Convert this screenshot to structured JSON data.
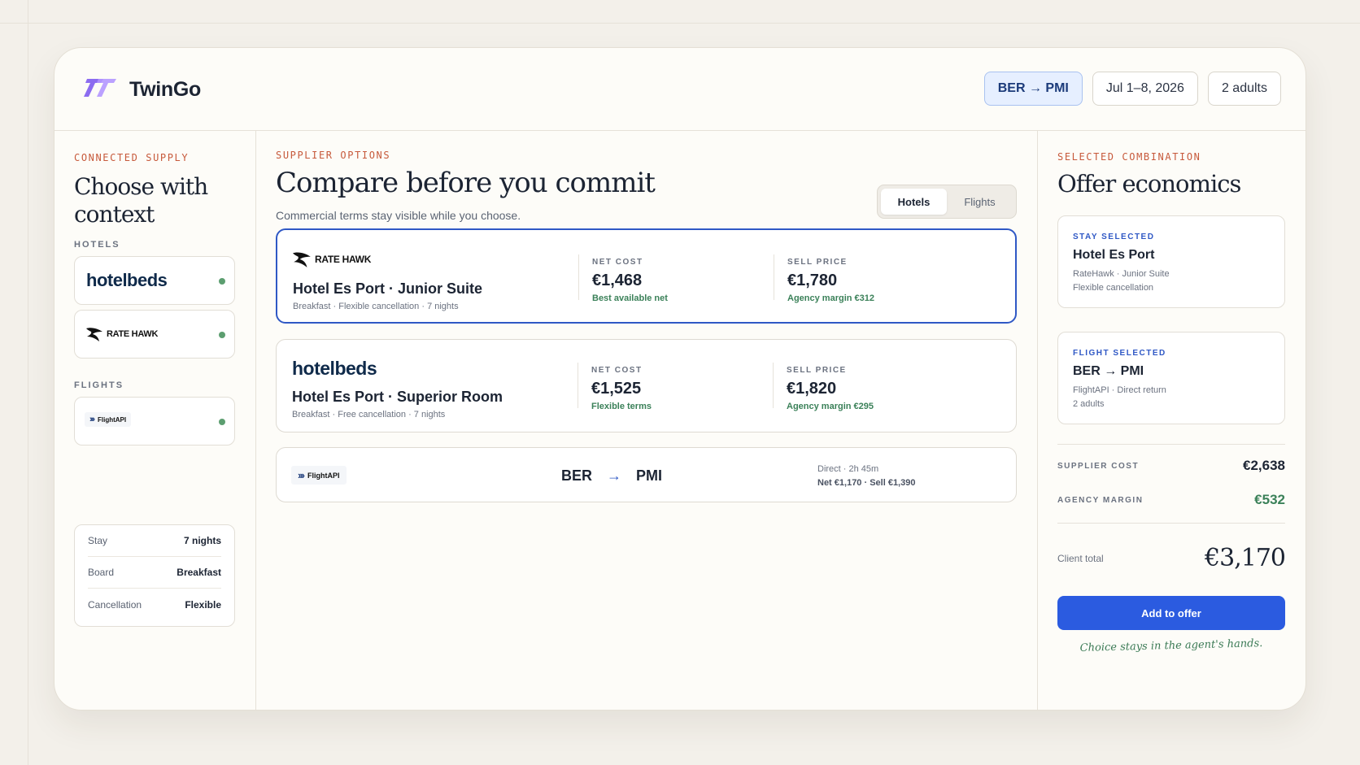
{
  "app": {
    "name": "TwinGo"
  },
  "header": {
    "route": "BER → PMI",
    "dates": "Jul 1–8, 2026",
    "travelers": "2 adults"
  },
  "left": {
    "eyebrow": "CONNECTED SUPPLY",
    "title": "Choose with context",
    "hotels_label": "HOTELS",
    "flights_label": "FLIGHTS",
    "suppliers": {
      "hotelbeds": "hotelbeds",
      "ratehawk": "RATE HAWK",
      "flightapi": "FlightAPI"
    },
    "details": [
      {
        "key": "Stay",
        "value": "7 nights"
      },
      {
        "key": "Board",
        "value": "Breakfast"
      },
      {
        "key": "Cancellation",
        "value": "Flexible"
      }
    ]
  },
  "middle": {
    "eyebrow": "SUPPLIER OPTIONS",
    "title": "Compare before you commit",
    "subtitle": "Commercial terms stay visible while you choose.",
    "toggle": {
      "hotels": "Hotels",
      "flights": "Flights",
      "active": "hotels"
    },
    "options": [
      {
        "supplier": "RATE HAWK",
        "name": "Hotel Es Port · Junior Suite",
        "meta": "Breakfast · Flexible cancellation · 7 nights",
        "net_label": "NET COST",
        "net": "€1,468",
        "net_note": "Best available net",
        "sell_label": "SELL PRICE",
        "sell": "€1,780",
        "sell_note": "Agency margin €312"
      },
      {
        "supplier": "hotelbeds",
        "name": "Hotel Es Port · Superior Room",
        "meta": "Breakfast · Free cancellation · 7 nights",
        "net_label": "NET COST",
        "net": "€1,525",
        "net_note": "Flexible terms",
        "sell_label": "SELL PRICE",
        "sell": "€1,820",
        "sell_note": "Agency margin €295"
      }
    ],
    "flight": {
      "supplier": "FlightAPI",
      "from": "BER",
      "to": "PMI",
      "info": "Direct · 2h 45m",
      "prices": "Net €1,170 · Sell €1,390"
    }
  },
  "right": {
    "eyebrow": "SELECTED COMBINATION",
    "title": "Offer economics",
    "stay": {
      "eyebrow": "STAY SELECTED",
      "title": "Hotel Es Port",
      "meta1": "RateHawk · Junior Suite",
      "meta2": "Flexible cancellation"
    },
    "flight": {
      "eyebrow": "FLIGHT SELECTED",
      "title": "BER → PMI",
      "meta1": "FlightAPI · Direct return",
      "meta2": "2 adults"
    },
    "supplier_cost_label": "SUPPLIER COST",
    "supplier_cost": "€2,638",
    "agency_margin_label": "AGENCY MARGIN",
    "agency_margin": "€532",
    "client_total_label": "Client total",
    "client_total": "€3,170",
    "add_button": "Add to offer",
    "tagline": "Choice stays in the agent's hands."
  },
  "colors": {
    "accent": "#2b5be0",
    "eyebrow": "#c75a3c",
    "positive": "#3b8159",
    "status_dot": "#5c9e70"
  }
}
